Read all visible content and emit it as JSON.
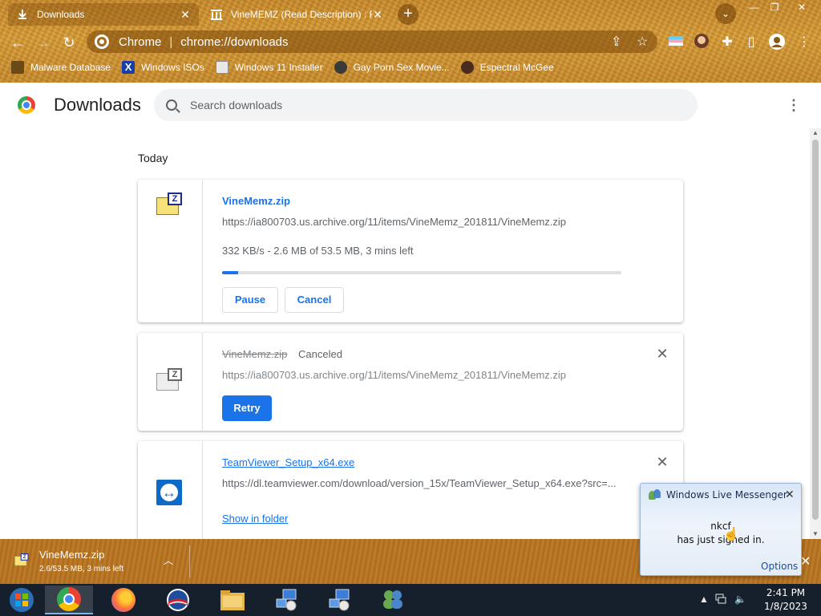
{
  "browser": {
    "tabs": [
      {
        "title": "Downloads",
        "icon": "download-icon"
      },
      {
        "title": "VineMEMZ (Read Description) : F",
        "icon": "archive-icon"
      }
    ],
    "omnibox": {
      "scheme_label": "Chrome",
      "separator": "|",
      "url": "chrome://downloads"
    },
    "bookmarks": [
      {
        "label": "Malware Database",
        "icon": "bookmark-icon-malware"
      },
      {
        "label": "Windows ISOs",
        "icon": "bookmark-icon-x"
      },
      {
        "label": "Windows 11 Installer",
        "icon": "bookmark-icon-installer"
      },
      {
        "label": "Gay Porn Sex Movie...",
        "icon": "bookmark-icon-movie"
      },
      {
        "label": "Espectral McGee",
        "icon": "bookmark-icon-avatar"
      }
    ],
    "theme_color": "#c98a2c"
  },
  "page": {
    "title": "Downloads",
    "search_placeholder": "Search downloads",
    "section_label": "Today"
  },
  "downloads": [
    {
      "name": "VineMemz.zip",
      "url": "https://ia800703.us.archive.org/11/items/VineMemz_201811/VineMemz.zip",
      "status": "332 KB/s - 2.6 MB of 53.5 MB, 3 mins left",
      "progress_fraction": 0.04,
      "buttons": [
        "Pause",
        "Cancel"
      ]
    },
    {
      "name": "VineMemz.zip",
      "state": "Canceled",
      "url": "https://ia800703.us.archive.org/11/items/VineMemz_201811/VineMemz.zip",
      "buttons": [
        "Retry"
      ],
      "close": "✕"
    },
    {
      "name": "TeamViewer_Setup_x64.exe",
      "url": "https://dl.teamviewer.com/download/version_15x/TeamViewer_Setup_x64.exe?src=...",
      "action": "Show in folder",
      "close": "✕"
    }
  ],
  "shelf": {
    "name": "VineMemz.zip",
    "status": "2.6/53.5 MB, 3 mins left"
  },
  "messenger_popup": {
    "title": "Windows Live Messenger",
    "user": "nkcf",
    "message": "has just signed in.",
    "options_label": "Options"
  },
  "taskbar": {
    "time": "2:41 PM",
    "date": "1/8/2023",
    "items": [
      "start-orb",
      "chrome",
      "firefox",
      "obama-icon",
      "file-explorer",
      "network-setup",
      "network-setup-2",
      "windows-live-messenger"
    ]
  },
  "colors": {
    "accent": "#1a73e8",
    "shelf": "#b8741f",
    "taskbar": "#16202c"
  }
}
